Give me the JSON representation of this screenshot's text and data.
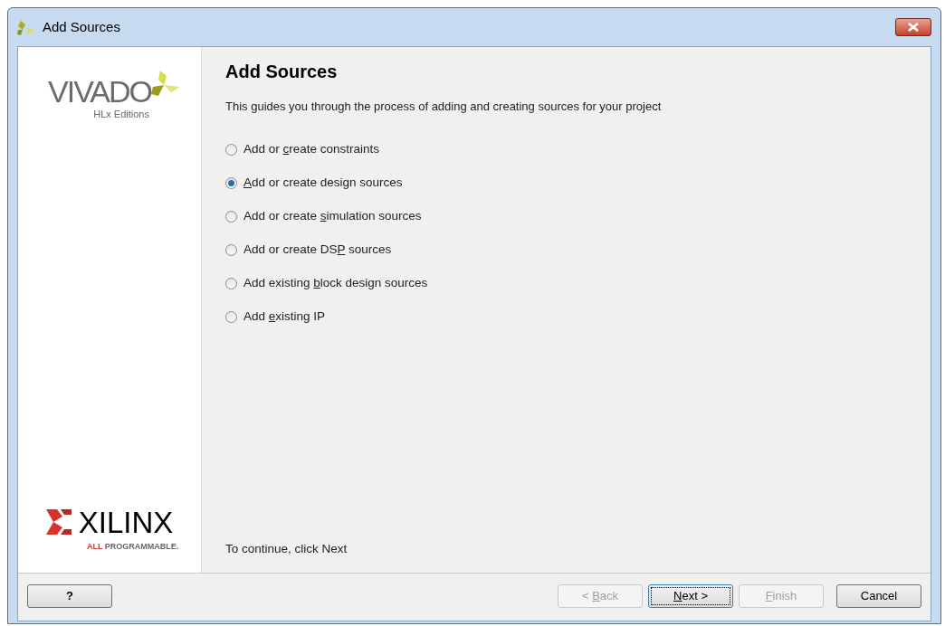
{
  "window": {
    "title": "Add Sources"
  },
  "sidebar": {
    "product_logo": {
      "name": "VIVADO",
      "subtitle": "HLx Editions"
    },
    "company_logo": {
      "name": "XILINX",
      "tagline_highlight": "ALL",
      "tagline": "PROGRAMMABLE."
    }
  },
  "page": {
    "title": "Add Sources",
    "description": "This guides you through the process of adding and creating sources for your project",
    "options": [
      {
        "label": {
          "before": "Add or ",
          "key": "c",
          "after": "reate constraints"
        },
        "selected": false
      },
      {
        "label": {
          "key": "A",
          "after": "dd or create design sources"
        },
        "selected": true
      },
      {
        "label": {
          "before": "Add or create ",
          "key": "s",
          "after": "imulation sources"
        },
        "selected": false
      },
      {
        "label": {
          "before": "Add or create DS",
          "key": "P",
          "after": " sources"
        },
        "selected": false
      },
      {
        "label": {
          "before": "Add existing ",
          "key": "b",
          "after": "lock design sources"
        },
        "selected": false
      },
      {
        "label": {
          "before": "Add ",
          "key": "e",
          "after": "xisting IP"
        },
        "selected": false
      }
    ],
    "hint": "To continue, click Next"
  },
  "buttons": [
    {
      "kind": "help",
      "label": {
        "before": "?"
      },
      "disabled": false,
      "focused": false
    },
    {
      "kind": "nav",
      "label": {
        "before": "< ",
        "key": "B",
        "after": "ack"
      },
      "disabled": true,
      "focused": false
    },
    {
      "kind": "nav",
      "label": {
        "key": "N",
        "after": "ext >"
      },
      "disabled": false,
      "focused": true
    },
    {
      "kind": "nav",
      "label": {
        "key": "F",
        "after": "inish"
      },
      "disabled": true,
      "focused": false
    },
    {
      "kind": "cancel",
      "label": {
        "before": "Cancel"
      },
      "disabled": false,
      "focused": false
    }
  ]
}
